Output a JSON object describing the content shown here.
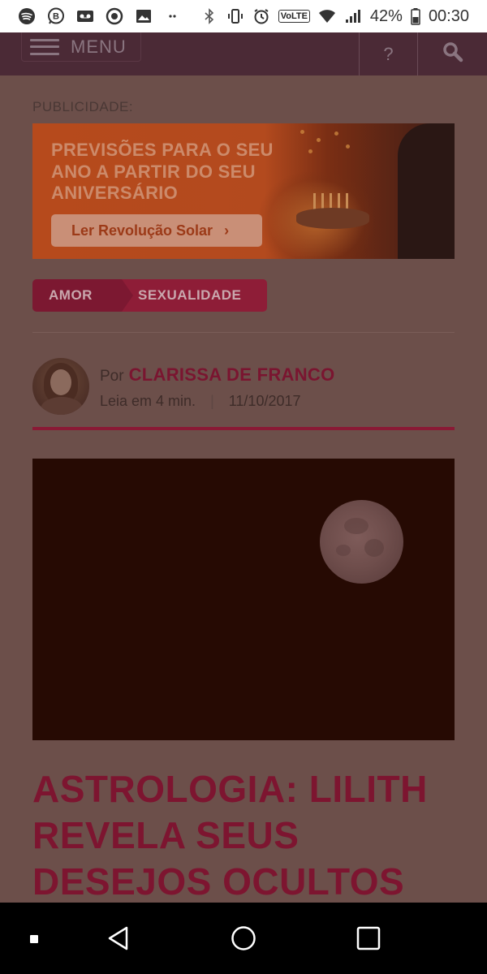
{
  "status_bar": {
    "icons_left": [
      "spotify-icon",
      "whatsapp-business-icon",
      "voicemail-icon",
      "circle-app-icon",
      "image-icon",
      "dots-icon"
    ],
    "icons_right": [
      "bluetooth-icon",
      "vibrate-icon",
      "alarm-icon",
      "volte-badge",
      "wifi-icon",
      "signal-icon",
      "battery-icon"
    ],
    "volte": "VoLTE",
    "battery": "42%",
    "time": "00:30"
  },
  "nav": {
    "menu_label": "MENU",
    "help_label": "?"
  },
  "ad": {
    "label": "PUBLICIDADE:",
    "title": "PREVISÕES PARA O SEU ANO A PARTIR DO SEU ANIVERSÁRIO",
    "button_label": "Ler Revolução Solar",
    "button_chevron": "›"
  },
  "tags": [
    "AMOR",
    "SEXUALIDADE"
  ],
  "author": {
    "by": "Por",
    "name": "CLARISSA DE FRANCO",
    "read_time": "Leia em 4 min.",
    "separator": "|",
    "date": "11/10/2017"
  },
  "article": {
    "headline": "ASTROLOGIA: LILITH REVELA SEUS DESEJOS OCULTOS"
  },
  "colors": {
    "overlay_bg": "#6c4f4a",
    "nav_bg": "#4b2a36",
    "accent": "#7d1530",
    "ad_orange": "#b64a1c"
  }
}
